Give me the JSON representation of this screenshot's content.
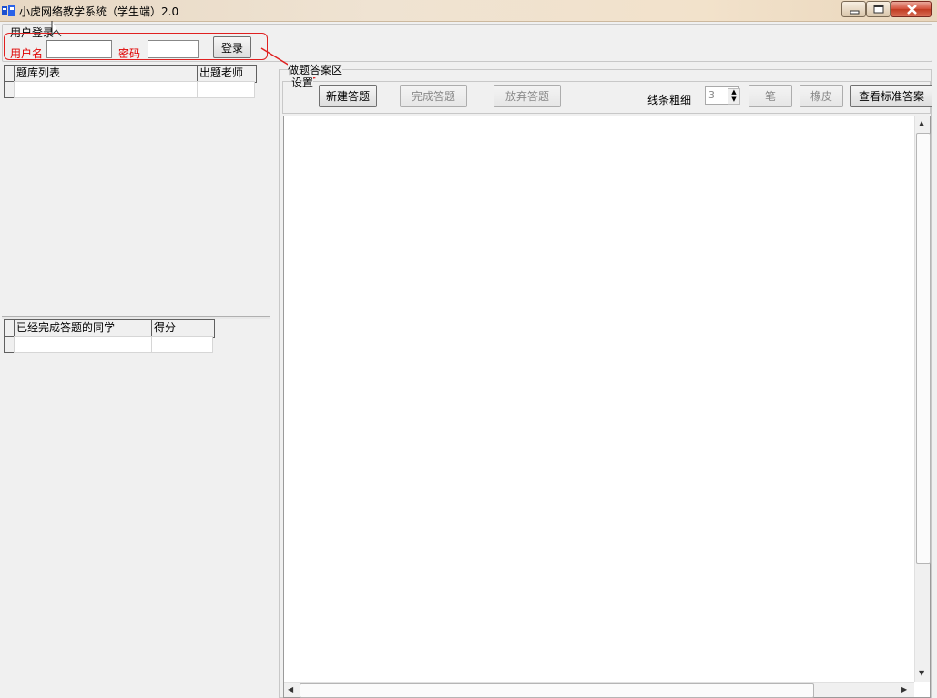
{
  "window": {
    "title": "小虎网络教学系统（学生端）2.0",
    "icon": "app-logo-icon",
    "controls": [
      "minimize-icon",
      "maximize-icon",
      "close-icon"
    ]
  },
  "login": {
    "group_label": "用户登录",
    "username_label": "用户名",
    "username_value": "",
    "password_label": "密码",
    "password_value": "",
    "login_button": "登录",
    "annotation_color": "#e02020"
  },
  "question_list": {
    "columns": [
      "题库列表",
      "出题老师"
    ],
    "rows": []
  },
  "completed_list": {
    "columns": [
      "已经完成答题的同学",
      "得分"
    ],
    "rows": []
  },
  "answer_area": {
    "group_label": "做题答案区",
    "settings": {
      "group_label": "设置",
      "new_answer": "新建答题",
      "finish_answer": "完成答题",
      "abandon_answer": "放弃答题",
      "line_width_label": "线条粗细",
      "line_width_value": "3",
      "pen": "笔",
      "eraser": "橡皮",
      "view_standard_answer": "查看标准答案"
    }
  }
}
